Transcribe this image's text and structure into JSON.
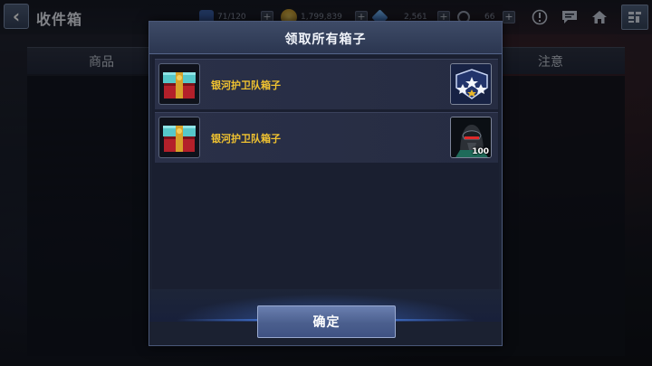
{
  "topbar": {
    "title": "收件箱",
    "back_icon": "chevron-left-icon",
    "resources": [
      {
        "name": "energy",
        "icon": "lightning-icon",
        "value": "71/120",
        "color": "#3a5fa8"
      },
      {
        "name": "gold",
        "icon": "gold-coin-icon",
        "value": "1,799,839",
        "color": "#c99a2e"
      },
      {
        "name": "crystal",
        "icon": "blue-crystal-icon",
        "value": "2,561",
        "color": "#3e7fd6"
      },
      {
        "name": "stamina",
        "icon": "refresh-arrow-icon",
        "value": "66",
        "color": "#9aa3b5"
      }
    ],
    "icons": [
      "alert-icon",
      "chat-icon",
      "home-icon",
      "menu-icon"
    ]
  },
  "table": {
    "col_items": "商品",
    "col_note": "注意"
  },
  "modal": {
    "title": "领取所有箱子",
    "rows": [
      {
        "name": "银河护卫队箱子",
        "thumb_icon": "gift-box-icon",
        "reward_icon": "rank-stars-badge-icon",
        "reward_qty": ""
      },
      {
        "name": "银河护卫队箱子",
        "thumb_icon": "gift-box-icon",
        "reward_icon": "hero-portrait-icon",
        "reward_qty": "100"
      }
    ],
    "confirm_label": "确定"
  }
}
